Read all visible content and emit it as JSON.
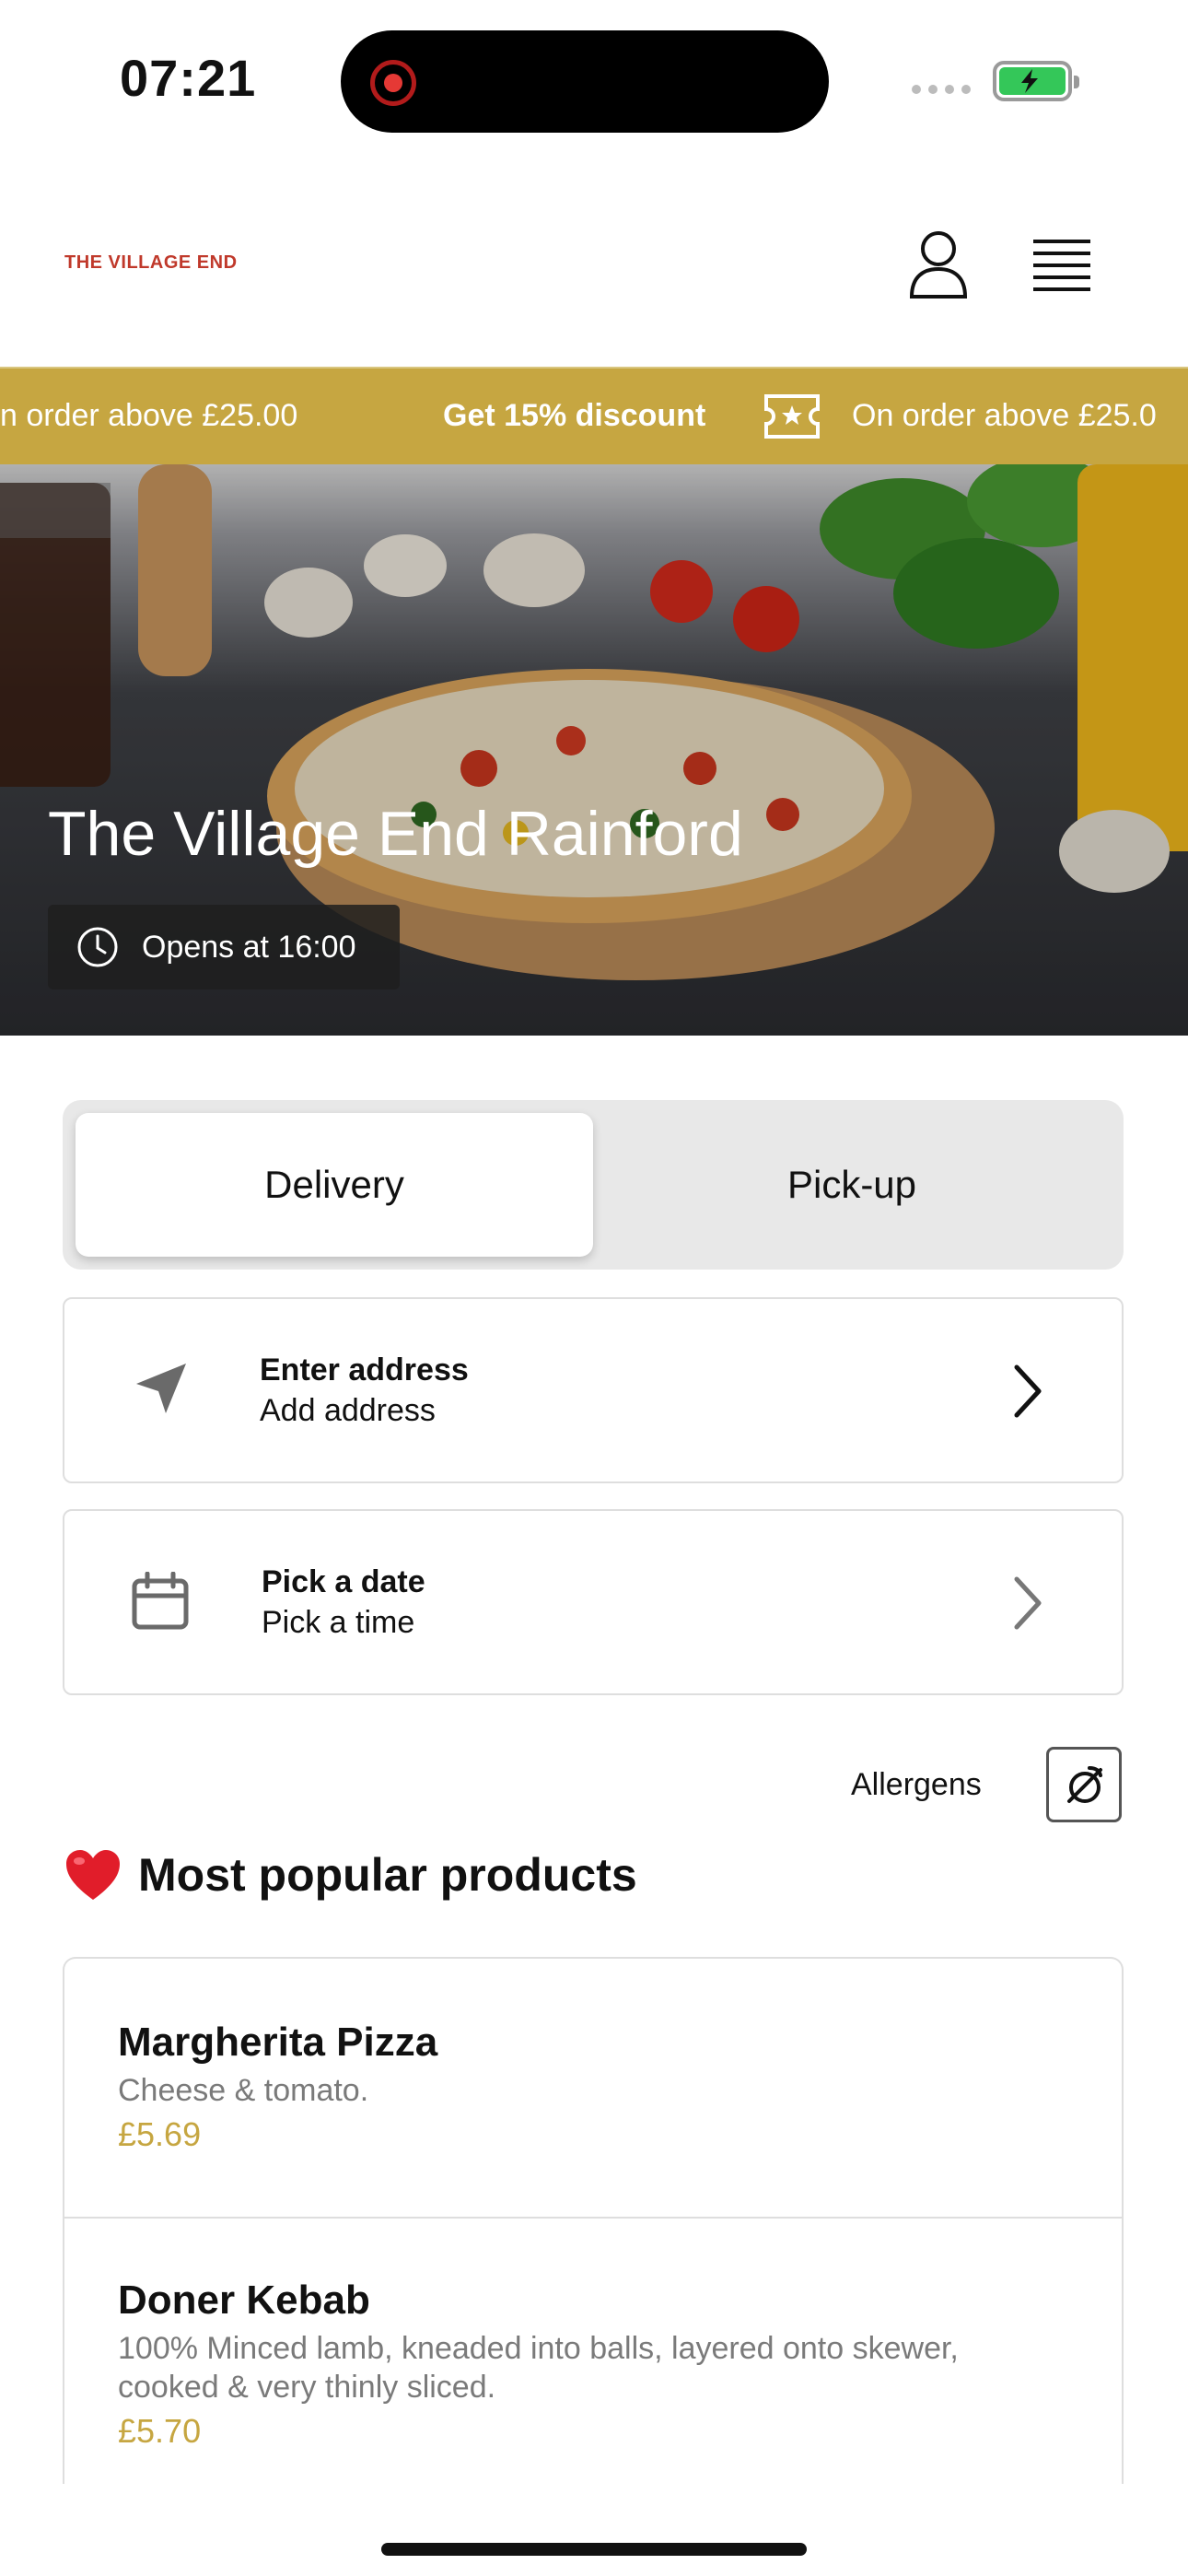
{
  "status_bar": {
    "time": "07:21"
  },
  "header": {
    "logo": "THE VILLAGE END"
  },
  "promo": {
    "left_text": "n order above £25.00",
    "headline": "Get 15% discount",
    "right_text": "On order above £25.0"
  },
  "hero": {
    "title": "The Village End Rainford",
    "opening": "Opens at 16:00"
  },
  "order_type": {
    "options": [
      "Delivery",
      "Pick-up"
    ],
    "selected": "Delivery"
  },
  "address": {
    "primary": "Enter address",
    "secondary": "Add address"
  },
  "schedule": {
    "primary": "Pick a date",
    "secondary": "Pick a time"
  },
  "allergens": {
    "label": "Allergens"
  },
  "popular": {
    "title": "Most popular products",
    "products": [
      {
        "name": "Margherita Pizza",
        "description": "Cheese & tomato.",
        "price": "£5.69"
      },
      {
        "name": "Doner Kebab",
        "description": "100% Minced lamb, kneaded into balls, layered onto skewer, cooked & very thinly sliced.",
        "price": "£5.70"
      }
    ]
  },
  "colors": {
    "accent": "#c6a641",
    "logo": "#c0392b",
    "battery": "#34c759"
  }
}
